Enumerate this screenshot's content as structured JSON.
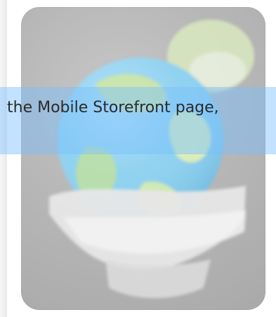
{
  "caption": {
    "text": "the Mobile Storefront page,"
  },
  "icon": {
    "name": "globe-cart-icon"
  },
  "colors": {
    "caption_band": "#78BEFF",
    "tile_gray": "#B7B7B7"
  }
}
